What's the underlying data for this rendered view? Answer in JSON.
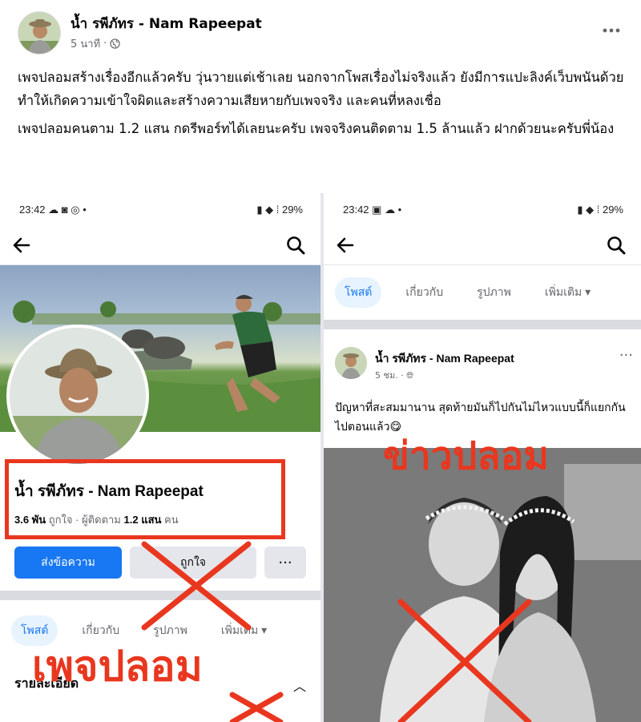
{
  "post": {
    "author": "น้ำ รพีภัทร - Nam Rapeepat",
    "time": "5 นาที",
    "more_icon": "more-horizontal-icon",
    "paragraphs": [
      "เพจปลอมสร้างเรื่องอีกแล้วครับ วุ่นวายแต่เช้าเลย นอกจากโพสเรื่องไม่จริงแล้ว ยังมีการแปะลิงค์เว็บพนันด้วย ทำให้เกิดความเข้าใจผิดและสร้างความเสียหายกับเพจจริง และคนที่หลงเชื่อ",
      "เพจปลอมคนตาม 1.2 แสน กดรีพอร์ทได้เลยนะครับ เพจจริงคนติดตาม 1.5 ล้านแล้ว ฝากด้วยนะครับพี่น้อง"
    ]
  },
  "left_shot": {
    "status_time": "23:42",
    "status_icons": "☁ ◙ ◎ •",
    "status_right": "29%",
    "page_name": "น้ำ รพีภัทร - Nam Rapeepat",
    "likes": "3.6 พัน",
    "likes_label": "ถูกใจ",
    "followers_label": "ผู้ติดตาม",
    "followers": "1.2 แสน",
    "followers_unit": "คน",
    "buttons": {
      "message": "ส่งข้อความ",
      "like": "ถูกใจ",
      "more": "···"
    },
    "tabs": [
      "โพสต์",
      "เกี่ยวกับ",
      "รูปภาพ",
      "เพิ่มเติม ▾"
    ],
    "details_label": "รายละเอียด",
    "overlay_label": "เพจปลอม"
  },
  "right_shot": {
    "status_time": "23:42",
    "status_icons": "▣ ☁ •",
    "status_right": "29%",
    "tabs": [
      "โพสต์",
      "เกี่ยวกับ",
      "รูปภาพ",
      "เพิ่มเติม ▾"
    ],
    "card_author": "น้ำ รพีภัทร - Nam Rapeepat",
    "card_time": "5 ชม.",
    "card_text": "ปัญหาที่สะสมมานาน สุดท้ายมันก็ไปกันไม่ไหวแบบนี้ก็แยกกันไปตอนแล้ว😋",
    "overlay_label": "ข่าวปลอม"
  },
  "colors": {
    "accent": "#1877f2",
    "warning": "#e9371f"
  }
}
